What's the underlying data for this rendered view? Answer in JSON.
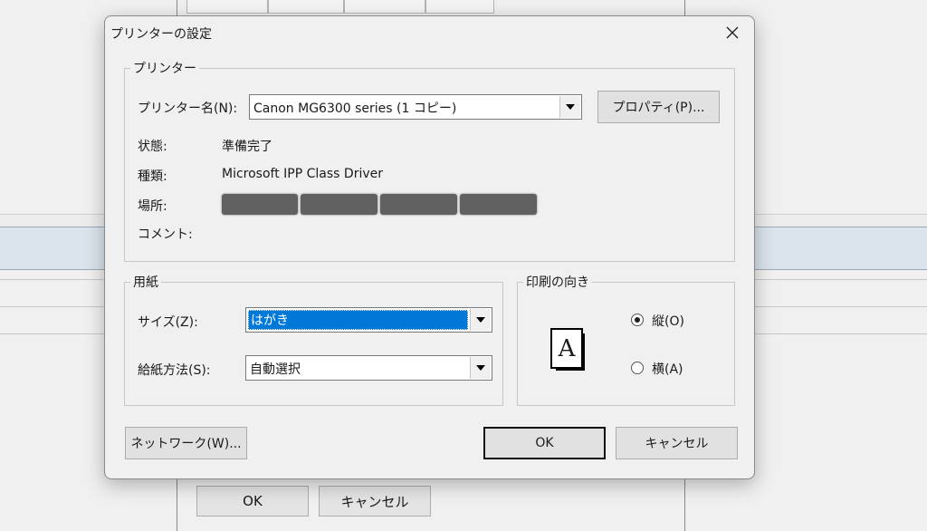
{
  "background_window": {
    "ok_label": "OK",
    "cancel_label": "キャンセル"
  },
  "dialog": {
    "title": "プリンターの設定",
    "close_icon": "close-icon",
    "printer_group": {
      "legend": "プリンター",
      "name_label": "プリンター名(N):",
      "name_value": "Canon MG6300 series (1 コピー)",
      "properties_button": "プロパティ(P)...",
      "status_label": "状態:",
      "status_value": "準備完了",
      "type_label": "種類:",
      "type_value": "Microsoft IPP Class Driver",
      "location_label": "場所:",
      "comment_label": "コメント:"
    },
    "paper_group": {
      "legend": "用紙",
      "size_label": "サイズ(Z):",
      "size_value": "はがき",
      "source_label": "給紙方法(S):",
      "source_value": "自動選択"
    },
    "orientation_group": {
      "legend": "印刷の向き",
      "icon_letter": "A",
      "portrait_label": "縦(O)",
      "portrait_selected": true,
      "landscape_label": "横(A)",
      "landscape_selected": false
    },
    "network_button": "ネットワーク(W)...",
    "ok_button": "OK",
    "cancel_button": "キャンセル"
  }
}
